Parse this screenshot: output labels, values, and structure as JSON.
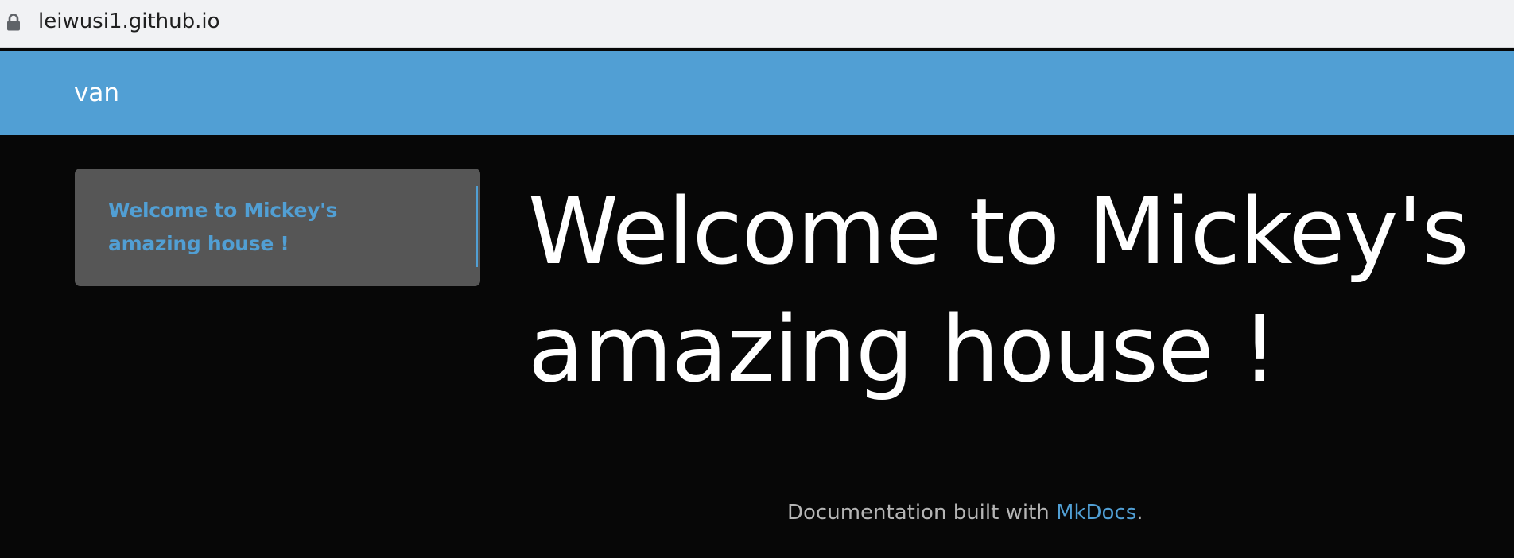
{
  "browser": {
    "url": "leiwusi1.github.io",
    "lock_icon": "lock-icon"
  },
  "navbar": {
    "brand": "van",
    "background": "#519fd4"
  },
  "sidebar": {
    "toc_items": [
      {
        "label": "Welcome to Mickey's amazing house !",
        "active": true
      }
    ]
  },
  "main": {
    "title": "Welcome to Mickey's amazing house !"
  },
  "footer": {
    "prefix": "Documentation built with ",
    "link_text": "MkDocs",
    "suffix": "."
  },
  "colors": {
    "accent": "#519fd4",
    "page_background": "#070707",
    "toc_background": "#565656"
  }
}
